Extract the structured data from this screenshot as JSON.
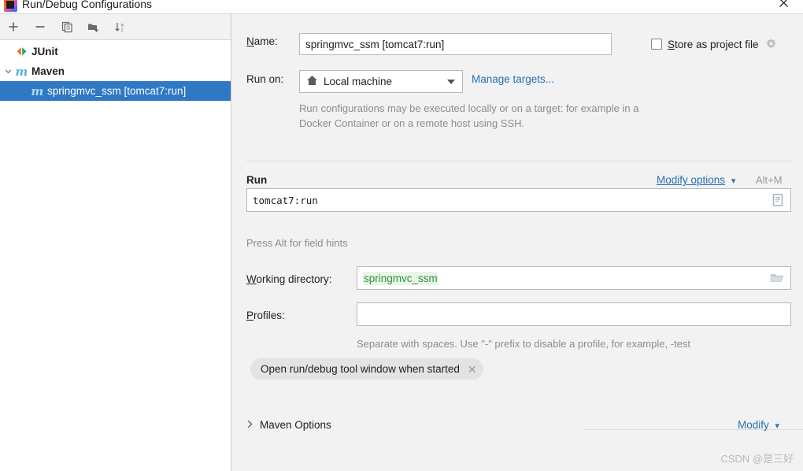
{
  "window": {
    "title": "Run/Debug Configurations",
    "app_icon": "intellij-idea-logo",
    "close_label": "×"
  },
  "left_panel": {
    "toolbar": [
      {
        "name": "add-configuration-button",
        "icon": "plus-icon",
        "label": "+"
      },
      {
        "name": "remove-configuration-button",
        "icon": "minus-icon",
        "label": "−"
      },
      {
        "name": "copy-configuration-button",
        "icon": "copy-icon",
        "label": "Copy"
      },
      {
        "name": "new-folder-button",
        "icon": "new-folder-icon",
        "label": "New Folder"
      },
      {
        "name": "sort-configurations-button",
        "icon": "sort-alphabetically-icon",
        "label": "Sort"
      }
    ],
    "tree": [
      {
        "label": "JUnit",
        "icon": "junit-icon",
        "level": 0,
        "selected": false,
        "expandable": false
      },
      {
        "label": "Maven",
        "icon": "maven-icon",
        "level": 0,
        "selected": false,
        "expandable": true
      },
      {
        "label": "springmvc_ssm [tomcat7:run]",
        "icon": "maven-icon",
        "level": 1,
        "selected": true,
        "expandable": false
      }
    ]
  },
  "form": {
    "name_label": "Name:",
    "name_label_mnemonic": "N",
    "name_value": "springmvc_ssm [tomcat7:run]",
    "store_as_project_file_label": "Store as project file",
    "store_as_project_file_mnemonic": "S",
    "store_as_project_file_checked": false,
    "store_gear_icon": "gear-icon",
    "run_on_label": "Run on:",
    "run_on_value": "Local machine",
    "run_on_icon": "home-icon",
    "manage_targets_link": "Manage targets...",
    "run_on_description": "Run configurations may be executed locally or on a target: for example in a Docker Container or on a remote host using SSH.",
    "run_section_title": "Run",
    "modify_options_link": "Modify options",
    "modify_options_shortcut": "Alt+M",
    "command_value": "tomcat7:run",
    "command_expand_icon": "expand-editor-icon",
    "field_hints_text": "Press Alt for field hints",
    "working_directory_label": "Working directory:",
    "working_directory_mnemonic": "W",
    "working_directory_value": "springmvc_ssm",
    "working_directory_browse_icon": "folder-open-icon",
    "profiles_label": "Profiles:",
    "profiles_mnemonic": "P",
    "profiles_value": "",
    "profiles_hint": "Separate with spaces. Use \"-\" prefix to disable a profile, for example, -test",
    "chips": [
      {
        "label": "Open run/debug tool window when started",
        "close_icon": "close-icon"
      }
    ],
    "maven_options_label": "Maven Options",
    "maven_options_expanded": false,
    "maven_options_modify_link": "Modify"
  },
  "watermark": "CSDN @是三好",
  "colors": {
    "selection_blue": "#2f78c4",
    "link_blue": "#2470b3",
    "panel_bg": "#f2f2f2",
    "tree_bg": "#ffffff",
    "green_value": "#3a8a3a",
    "green_value_bg": "#e8f7e8",
    "hint_gray": "#8c8c8c"
  }
}
